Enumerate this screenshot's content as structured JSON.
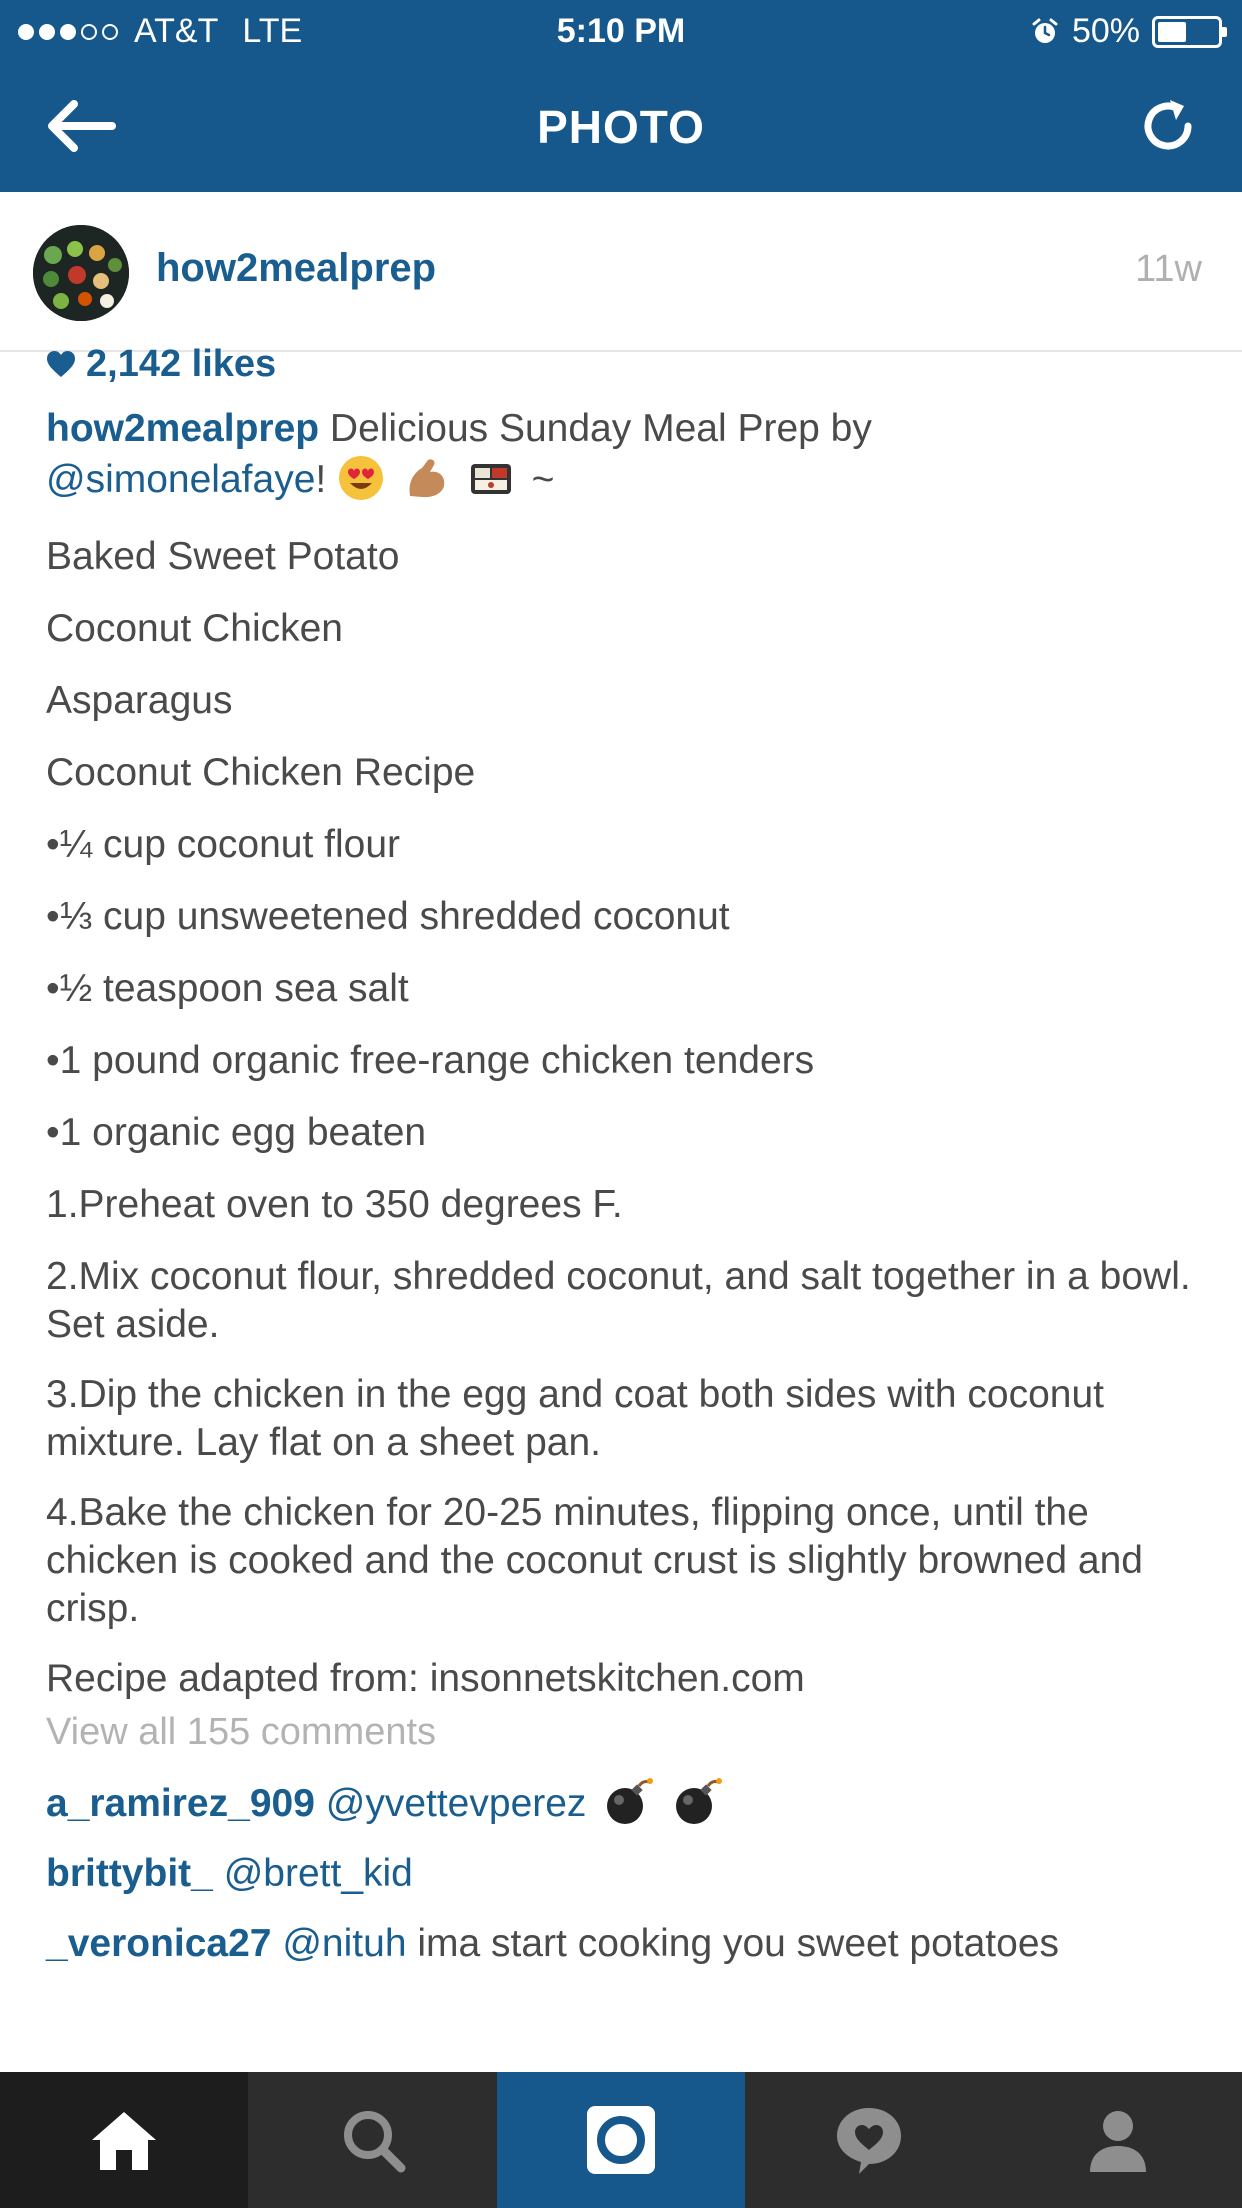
{
  "status_bar": {
    "carrier": "AT&T",
    "network": "LTE",
    "time": "5:10 PM",
    "battery_percent": "50%",
    "signal_bars_filled": 3,
    "signal_bars_total": 5,
    "battery_level": 0.5
  },
  "nav": {
    "title": "PHOTO",
    "back_icon": "back-arrow-icon",
    "refresh_icon": "refresh-icon"
  },
  "post": {
    "username": "how2mealprep",
    "timestamp": "11w",
    "likes": "2,142 likes",
    "caption": {
      "user": "how2mealprep",
      "text": " Delicious Sunday Meal Prep by ",
      "mention": "@simonelafaye",
      "after_mention": "! ",
      "tail": " ~"
    },
    "lines": [
      "Baked Sweet Potato",
      "Coconut Chicken",
      "Asparagus",
      "Coconut Chicken Recipe",
      "•¼ cup coconut flour",
      "•⅓ cup unsweetened shredded coconut",
      "•½ teaspoon sea salt",
      "•1 pound organic free-range chicken tenders",
      "•1 organic egg beaten",
      "1.Preheat oven to 350 degrees F.",
      "2.Mix coconut flour, shredded coconut, and salt together in a bowl. Set aside.",
      "3.Dip the chicken in the egg and coat both sides with coconut mixture. Lay flat on a sheet pan.",
      "4.Bake the chicken for 20-25 minutes, flipping once, until the chicken is cooked and the coconut crust is slightly browned and crisp.",
      "Recipe adapted from: insonnetskitchen.com"
    ],
    "view_comments": "View all 155 comments",
    "comments": [
      {
        "user": "a_ramirez_909",
        "mention": "@yvettevperez",
        "text": ""
      },
      {
        "user": "brittybit_",
        "mention": "@brett_kid",
        "text": ""
      },
      {
        "user": "_veronica27",
        "mention": "@nituh",
        "text": " ima start cooking you sweet potatoes"
      }
    ]
  },
  "tabbar": {
    "tabs": [
      "home-icon",
      "search-icon",
      "camera-icon",
      "activity-icon",
      "profile-icon"
    ],
    "active": "camera-icon"
  },
  "colors": {
    "brand_blue": "#16588c",
    "link_blue": "#1a5d8f",
    "text_gray": "#4a4a4a",
    "muted_gray": "#b3b3b3"
  }
}
